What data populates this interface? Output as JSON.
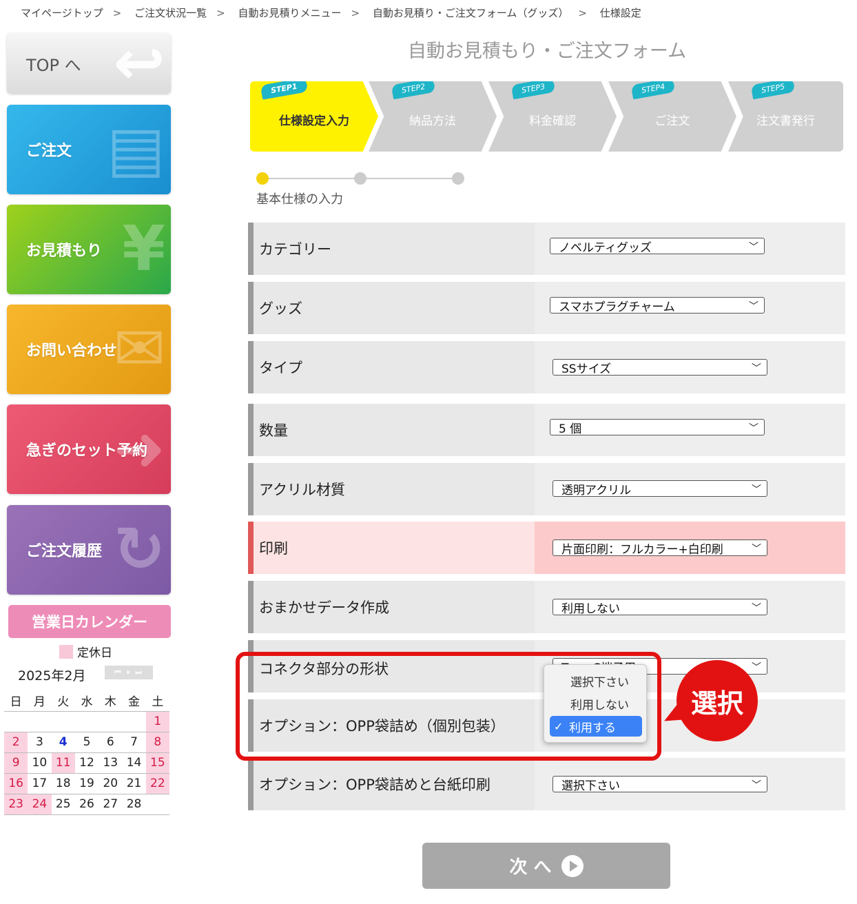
{
  "breadcrumb": [
    "マイページトップ",
    "ご注文状況一覧",
    "自動お見積りメニュー",
    "自動お見積り・ご注文フォーム（グッズ）",
    "仕様設定"
  ],
  "breadcrumb_sep": ">",
  "sidebar": {
    "top": "TOP へ",
    "order": "ご注文",
    "estimate": "お見積もり",
    "contact": "お問い合わせ",
    "urgent": "急ぎのセット予約",
    "history": "ご注文履歴"
  },
  "calendar": {
    "title": "営業日カレンダー",
    "legend": "定休日",
    "month": "2025年2月",
    "weekdays": [
      "日",
      "月",
      "火",
      "水",
      "木",
      "金",
      "土"
    ],
    "weeks": [
      [
        "",
        "",
        "",
        "",
        "",
        "",
        "1"
      ],
      [
        "2",
        "3",
        "4",
        "5",
        "6",
        "7",
        "8"
      ],
      [
        "9",
        "10",
        "11",
        "12",
        "13",
        "14",
        "15"
      ],
      [
        "16",
        "17",
        "18",
        "19",
        "20",
        "21",
        "22"
      ],
      [
        "23",
        "24",
        "25",
        "26",
        "27",
        "28",
        ""
      ]
    ],
    "holidays": [
      "1",
      "2",
      "8",
      "9",
      "11",
      "15",
      "16",
      "22",
      "23",
      "24"
    ],
    "today": "4"
  },
  "page_title": "自動お見積もり・ご注文フォーム",
  "steps": [
    {
      "badge": "STEP1",
      "label": "仕様設定入力"
    },
    {
      "badge": "STEP2",
      "label": "納品方法"
    },
    {
      "badge": "STEP3",
      "label": "料金確認"
    },
    {
      "badge": "STEP4",
      "label": "ご注文"
    },
    {
      "badge": "STEP5",
      "label": "注文書発行"
    }
  ],
  "progress_label": "基本仕様の入力",
  "form": {
    "category": {
      "label": "カテゴリー",
      "value": "ノベルティグッズ"
    },
    "goods": {
      "label": "グッズ",
      "value": "スマホプラグチャーム"
    },
    "type": {
      "label": "タイプ",
      "value": "SSサイズ"
    },
    "quantity": {
      "label": "数量",
      "value": "5 個"
    },
    "material": {
      "label": "アクリル材質",
      "value": "透明アクリル"
    },
    "print": {
      "label": "印刷",
      "value": "片面印刷：フルカラー+白印刷"
    },
    "data": {
      "label": "おまかせデータ作成",
      "value": "利用しない"
    },
    "connector": {
      "label": "コネクタ部分の形状",
      "value": "Type-C端子用"
    },
    "opp": {
      "label": "オプション：OPP袋詰め（個別包装）",
      "value": "利用する"
    },
    "opp_print": {
      "label": "オプション：OPP袋詰めと台紙印刷",
      "value": "選択下さい"
    }
  },
  "dropdown": {
    "options": [
      "選択下さい",
      "利用しない",
      "利用する"
    ],
    "selected": "利用する"
  },
  "callout": "選択",
  "next_button": "次 へ",
  "colors": {
    "accent": "#e31212",
    "active_step": "#fff200",
    "step_badge": "#1fb5c8"
  }
}
